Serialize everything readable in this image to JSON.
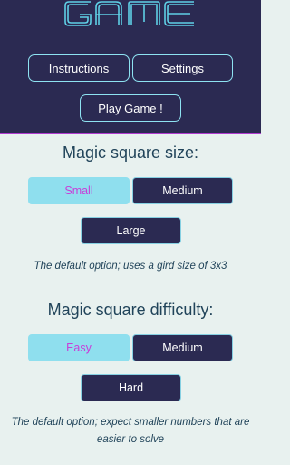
{
  "header": {
    "logo_text": "GAME",
    "instructions_label": "Instructions",
    "settings_label": "Settings",
    "play_label": "Play Game !"
  },
  "size_section": {
    "title": "Magic square size:",
    "options": [
      "Small",
      "Medium",
      "Large"
    ],
    "selected": "Small",
    "note": "The default option; uses a gird size of 3x3"
  },
  "difficulty_section": {
    "title": "Magic square difficulty:",
    "options": [
      "Easy",
      "Medium",
      "Hard"
    ],
    "selected": "Easy",
    "note": "The default option; expect smaller numbers that are easier to solve"
  },
  "colors": {
    "header_bg": "#2b2a52",
    "accent_cyan": "#8ee3f2",
    "accent_magenta": "#c83ed8",
    "page_bg": "#e8f1ef"
  }
}
